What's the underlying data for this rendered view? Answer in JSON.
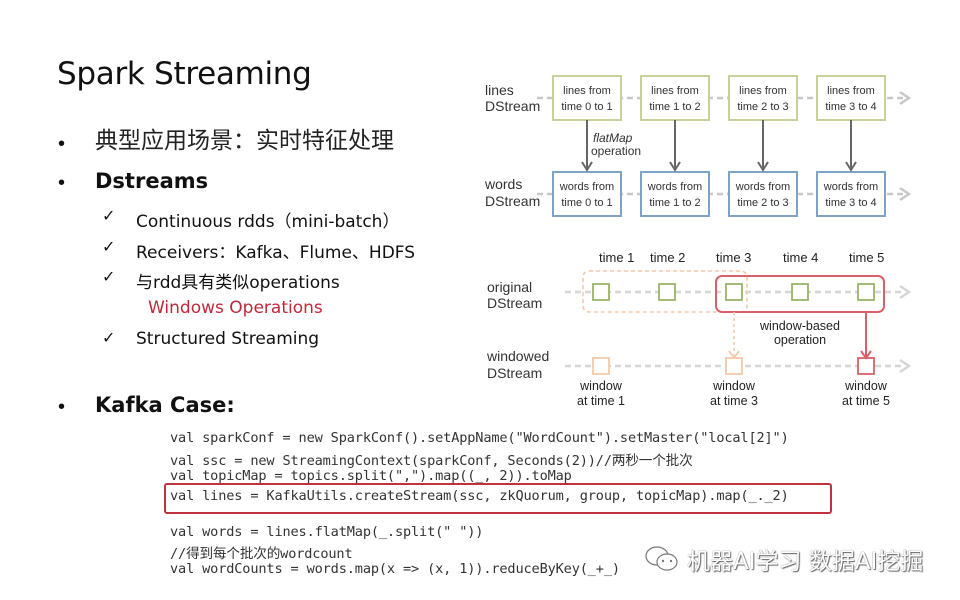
{
  "slide": {
    "title": "Spark Streaming",
    "bullets": [
      {
        "text": "典型应用场景：实时特征处理"
      },
      {
        "text": "Dstreams"
      },
      {
        "text": "Kafka Case:"
      }
    ],
    "dstream_items": [
      "Continuous rdds（mini-batch）",
      "Receivers：Kafka、Flume、HDFS",
      "与rdd具有类似operations",
      "Structured Streaming"
    ],
    "windows_note": "Windows Operations",
    "bullet_glyph": "•",
    "check_glyph": "✓"
  },
  "diagram_top": {
    "row_labels": [
      [
        "lines",
        "DStream"
      ],
      [
        "words",
        "DStream"
      ]
    ],
    "lines_boxes": [
      [
        "lines from",
        "time 0 to 1"
      ],
      [
        "lines from",
        "time 1 to 2"
      ],
      [
        "lines from",
        "time 2 to 3"
      ],
      [
        "lines from",
        "time 3 to 4"
      ]
    ],
    "words_boxes": [
      [
        "words from",
        "time 0 to 1"
      ],
      [
        "words from",
        "time 1 to 2"
      ],
      [
        "words from",
        "time 2 to 3"
      ],
      [
        "words from",
        "time 3 to 4"
      ]
    ],
    "op_label_italic": "flatMap",
    "op_label": "operation",
    "colors": {
      "lines_border": "#c8d19a",
      "words_border": "#7fa3c4",
      "arrow": "#666666",
      "dash": "#c8c8c8"
    }
  },
  "diagram_bottom": {
    "time_labels": [
      "time 1",
      "time 2",
      "time 3",
      "time 4",
      "time 5"
    ],
    "row_labels": [
      [
        "original",
        "DStream"
      ],
      [
        "windowed",
        "DStream"
      ]
    ],
    "window_op_label": [
      "window-based",
      "operation"
    ],
    "window_labels": [
      [
        "window",
        "at time 1"
      ],
      [
        "window",
        "at time 3"
      ],
      [
        "window",
        "at time 5"
      ]
    ],
    "colors": {
      "green": "#9cb36a",
      "peach": "#f3c9a8",
      "red": "#d9606a",
      "dash": "#d6d6d6"
    }
  },
  "code": {
    "lines": [
      "val sparkConf = new SparkConf().setAppName(\"WordCount\").setMaster(\"local[2]\")",
      "val ssc = new StreamingContext(sparkConf, Seconds(2))//两秒一个批次",
      "val topicMap = topics.split(\",\").map((_, 2)).toMap",
      "val lines = KafkaUtils.createStream(ssc, zkQuorum, group, topicMap).map(_._2)",
      "val words = lines.flatMap(_.split(\" \"))",
      "//得到每个批次的wordcount",
      "val wordCounts = words.map(x => (x, 1)).reduceByKey(_+_)"
    ],
    "highlight_color": "#c0303e"
  },
  "watermark": {
    "icon": "wechat-icon",
    "text": "机器AI学习 数据AI挖掘"
  }
}
